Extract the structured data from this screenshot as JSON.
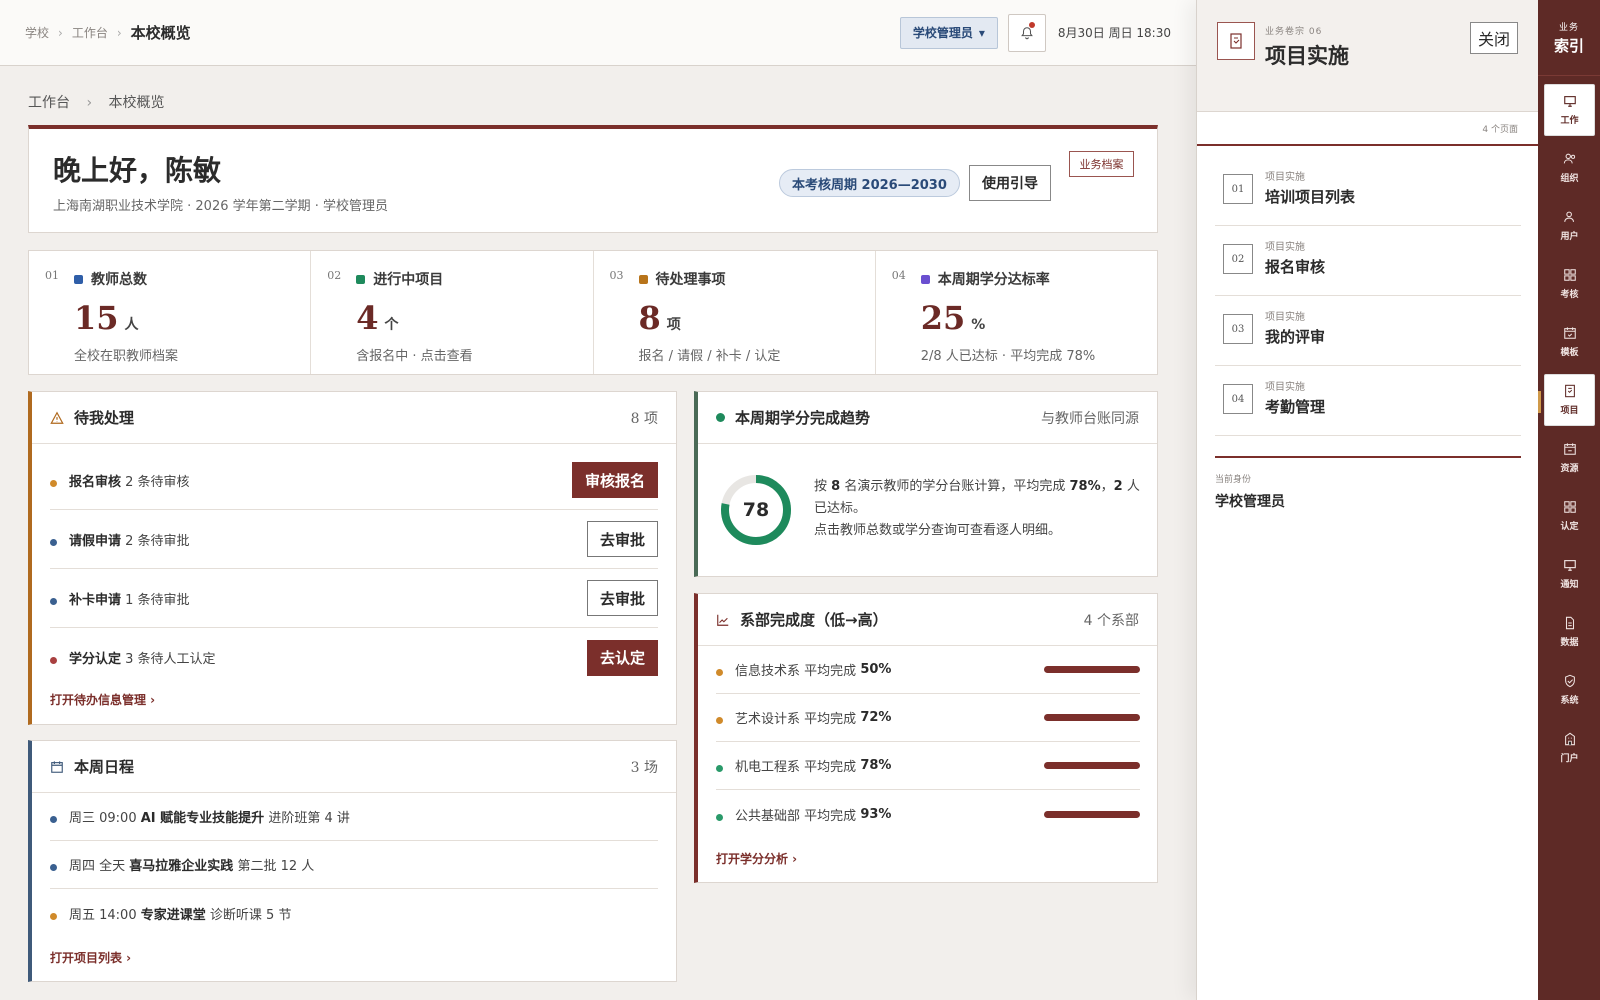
{
  "topbar": {
    "crumbs": [
      "学校",
      "工作台",
      "本校概览"
    ],
    "role_label": "学校管理员",
    "datetime": "8月30日 周日 18:30"
  },
  "sub_crumbs": [
    "工作台",
    "本校概览"
  ],
  "welcome": {
    "greeting": "晚上好，陈敏",
    "meta": "上海南湖职业技术学院 · 2026 学年第二学期 · 学校管理员",
    "period": "本考核周期 2026—2030",
    "guide_label": "使用引导",
    "archive_label": "业务档案"
  },
  "stats": [
    {
      "idx": "01",
      "label": "教师总数",
      "value": "15",
      "unit": "人",
      "desc": "全校在职教师档案",
      "color": "#2f5ea8"
    },
    {
      "idx": "02",
      "label": "进行中项目",
      "value": "4",
      "unit": "个",
      "desc": "含报名中 · 点击查看",
      "color": "#1e8a5c"
    },
    {
      "idx": "03",
      "label": "待处理事项",
      "value": "8",
      "unit": "项",
      "desc": "报名 / 请假 / 补卡 / 认定",
      "color": "#b8741a"
    },
    {
      "idx": "04",
      "label": "本周期学分达标率",
      "value": "25",
      "unit": "%",
      "desc": "2/8 人已达标 · 平均完成 78%",
      "color": "#6a4fd0"
    }
  ],
  "pending": {
    "title": "待我处理",
    "count": "8 项",
    "rows": [
      {
        "name": "报名审核",
        "detail": "2 条待审核",
        "action": "审核报名",
        "style": "fill",
        "color": "#d08a2a"
      },
      {
        "name": "请假申请",
        "detail": "2 条待审批",
        "action": "去审批",
        "style": "line",
        "color": "#3a6090"
      },
      {
        "name": "补卡申请",
        "detail": "1 条待审批",
        "action": "去审批",
        "style": "line",
        "color": "#3a6090"
      },
      {
        "name": "学分认定",
        "detail": "3 条待人工认定",
        "action": "去认定",
        "style": "fill",
        "color": "#a94040"
      }
    ],
    "link": "打开待办信息管理 ›"
  },
  "schedule": {
    "title": "本周日程",
    "count": "3 场",
    "rows": [
      {
        "time": "周三 09:00",
        "name": "AI 赋能专业技能提升",
        "detail": "进阶班第 4 讲",
        "color": "#3a6090"
      },
      {
        "time": "周四 全天",
        "name": "喜马拉雅企业实践",
        "detail": "第二批 12 人",
        "color": "#3a6090"
      },
      {
        "time": "周五 14:00",
        "name": "专家进课堂",
        "detail": "诊断听课 5 节",
        "color": "#d08a2a"
      }
    ],
    "link": "打开项目列表 ›"
  },
  "trend": {
    "title": "本周期学分完成趋势",
    "note": "与教师台账同源",
    "percent": 78,
    "percent_text": "78",
    "desc_1": "按",
    "desc_teachers": "8",
    "desc_2": "名演示教师的学分台账计算，平均完成",
    "desc_avg": "78%",
    "desc_3": "，",
    "desc_met": "2",
    "desc_4": "人已达标。",
    "desc_line2": "点击教师总数或学分查询可查看逐人明细。"
  },
  "dept": {
    "title": "系部完成度（低→高）",
    "count": "4 个系部",
    "rows": [
      {
        "name": "信息技术系",
        "label": "平均完成",
        "value": "50%",
        "color": "#d08a2a"
      },
      {
        "name": "艺术设计系",
        "label": "平均完成",
        "value": "72%",
        "color": "#d08a2a"
      },
      {
        "name": "机电工程系",
        "label": "平均完成",
        "value": "78%",
        "color": "#2a9a6a"
      },
      {
        "name": "公共基础部",
        "label": "平均完成",
        "value": "93%",
        "color": "#2a9a6a"
      }
    ],
    "link": "打开学分分析 ›"
  },
  "drawer": {
    "kicker": "业务卷宗 06",
    "title": "项目实施",
    "close_label": "关闭",
    "page_count": "4 个页面",
    "items": [
      {
        "idx": "01",
        "kicker": "项目实施",
        "title": "培训项目列表"
      },
      {
        "idx": "02",
        "kicker": "项目实施",
        "title": "报名审核"
      },
      {
        "idx": "03",
        "kicker": "项目实施",
        "title": "我的评审"
      },
      {
        "idx": "04",
        "kicker": "项目实施",
        "title": "考勤管理"
      }
    ],
    "identity_label": "当前身份",
    "identity_value": "学校管理员"
  },
  "rail": {
    "head_small": "业务",
    "head_big": "索引",
    "items": [
      {
        "label": "工作",
        "icon": "monitor-icon",
        "active": false
      },
      {
        "label": "组织",
        "icon": "users-icon",
        "active": false
      },
      {
        "label": "用户",
        "icon": "user-icon",
        "active": false
      },
      {
        "label": "考核",
        "icon": "grid-icon",
        "active": false
      },
      {
        "label": "模板",
        "icon": "calendar-icon",
        "active": false
      },
      {
        "label": "项目",
        "icon": "document-icon",
        "active": true
      },
      {
        "label": "资源",
        "icon": "calendar-icon",
        "active": false
      },
      {
        "label": "认定",
        "icon": "grid-icon",
        "active": false
      },
      {
        "label": "通知",
        "icon": "monitor-icon",
        "active": false
      },
      {
        "label": "数据",
        "icon": "file-icon",
        "active": false
      },
      {
        "label": "系统",
        "icon": "shield-icon",
        "active": false
      },
      {
        "label": "门户",
        "icon": "building-icon",
        "active": false
      }
    ]
  },
  "colors": {
    "brand": "#7b2f2b",
    "rail": "#5e2a26",
    "donut": "#1e8a5c"
  }
}
